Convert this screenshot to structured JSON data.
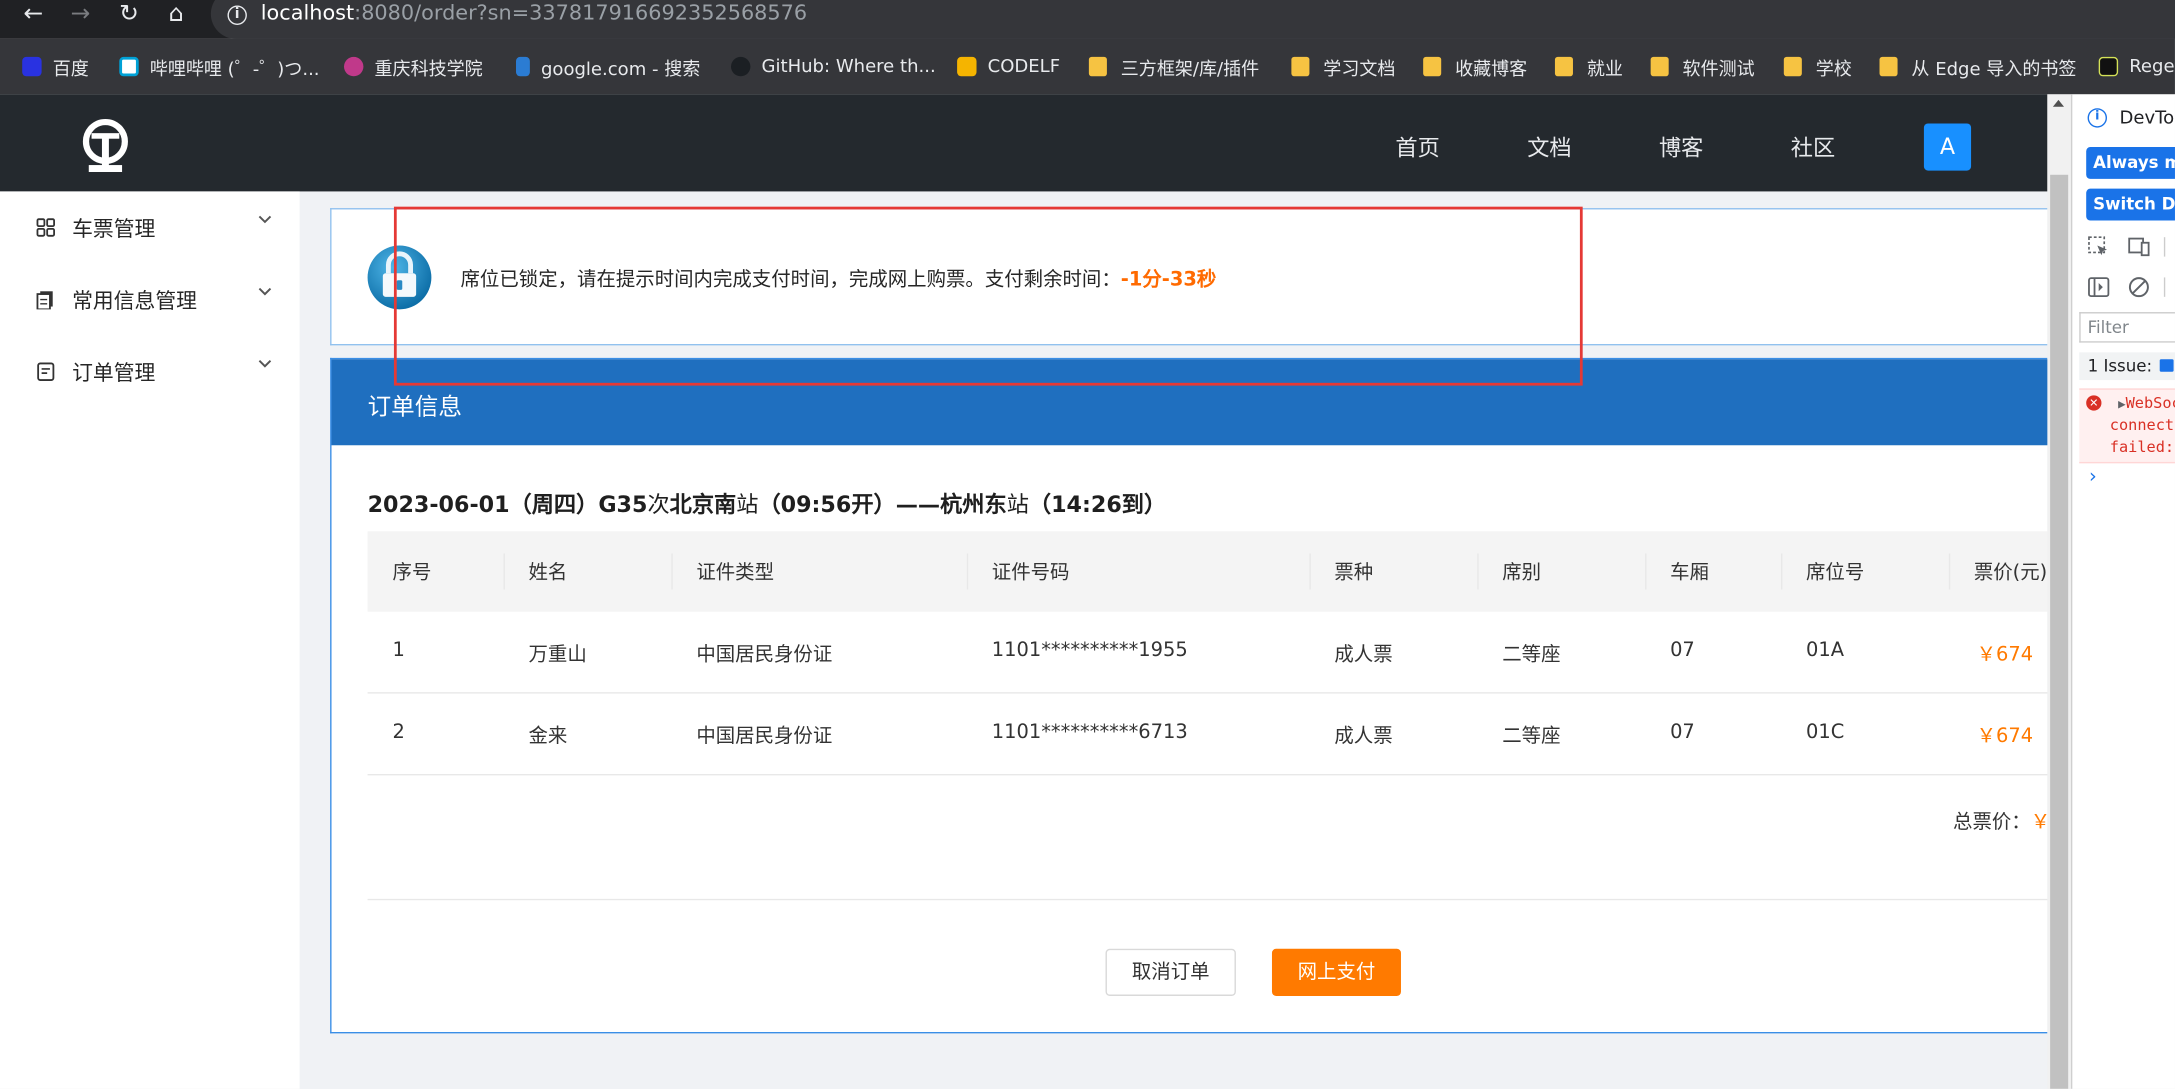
{
  "browser": {
    "url_host": "localhost",
    "url_rest": ":8080/order?sn=337817916692352568576",
    "bookmarks": [
      {
        "label": "百度",
        "icon": "baidu-icon",
        "color": "#2932e1"
      },
      {
        "label": "哔哩哔哩 (゜-゜)つ...",
        "icon": "bilibili-icon",
        "color": "#00a1d6"
      },
      {
        "label": "重庆科技学院",
        "icon": "school-logo-icon",
        "color": "#c0398a"
      },
      {
        "label": "google.com - 搜索",
        "icon": "bing-icon",
        "color": "#2b7cd3"
      },
      {
        "label": "GitHub: Where th...",
        "icon": "github-icon",
        "color": "#24292e"
      },
      {
        "label": "CODELF",
        "icon": "codelf-icon",
        "color": "#f5b400"
      },
      {
        "label": "三方框架/库/插件",
        "icon": "folder-icon"
      },
      {
        "label": "学习文档",
        "icon": "folder-icon"
      },
      {
        "label": "收藏博客",
        "icon": "folder-icon"
      },
      {
        "label": "就业",
        "icon": "folder-icon"
      },
      {
        "label": "软件测试",
        "icon": "folder-icon"
      },
      {
        "label": "学校",
        "icon": "folder-icon"
      },
      {
        "label": "从 Edge 导入的书签",
        "icon": "folder-icon"
      },
      {
        "label": "Rege",
        "icon": "regex-icon",
        "color": "#111111"
      }
    ]
  },
  "header": {
    "nav": [
      "首页",
      "文档",
      "博客",
      "社区"
    ],
    "avatar_letter": "A"
  },
  "sidebar": {
    "items": [
      {
        "label": "车票管理"
      },
      {
        "label": "常用信息管理"
      },
      {
        "label": "订单管理"
      }
    ]
  },
  "alert": {
    "message": "席位已锁定，请在提示时间内完成支付时间，完成网上购票。支付剩余时间：",
    "remaining_time": "-1分-33秒"
  },
  "order": {
    "title": "订单信息",
    "trip": {
      "date": "2023-06-01（周四）",
      "train": "G35",
      "train_suffix": "次",
      "from": "北京南",
      "station_suffix": "站",
      "depart": "（09:56开）——",
      "to": "杭州东",
      "arrive": "（14:26到）"
    },
    "columns": [
      "序号",
      "姓名",
      "证件类型",
      "证件号码",
      "票种",
      "席别",
      "车厢",
      "席位号",
      "票价(元)"
    ],
    "rows": [
      {
        "no": "1",
        "name": "万重山",
        "id_type": "中国居民身份证",
        "id_no": "1101**********1955",
        "ticket_type": "成人票",
        "seat_class": "二等座",
        "coach": "07",
        "seat_no": "01A",
        "price": "￥674"
      },
      {
        "no": "2",
        "name": "金来",
        "id_type": "中国居民身份证",
        "id_no": "1101**********6713",
        "ticket_type": "成人票",
        "seat_class": "二等座",
        "coach": "07",
        "seat_no": "01C",
        "price": "￥674"
      }
    ],
    "total_label": "总票价：",
    "total_value": "￥",
    "cancel_label": "取消订单",
    "pay_label": "网上支付"
  },
  "devtools": {
    "title": "DevTools",
    "btn_always": "Always match Chrome's language",
    "btn_switch": "Switch DevTools to Chinese",
    "filter_placeholder": "Filter",
    "issues": "1 Issue:",
    "error_lines": [
      "WebSocket",
      "connection",
      "failed:"
    ],
    "prompt": "›"
  },
  "colors": {
    "accent": "#1890ff",
    "order_header": "#1f6fbf",
    "price": "#ff7a00",
    "annotation": "#e53935"
  }
}
